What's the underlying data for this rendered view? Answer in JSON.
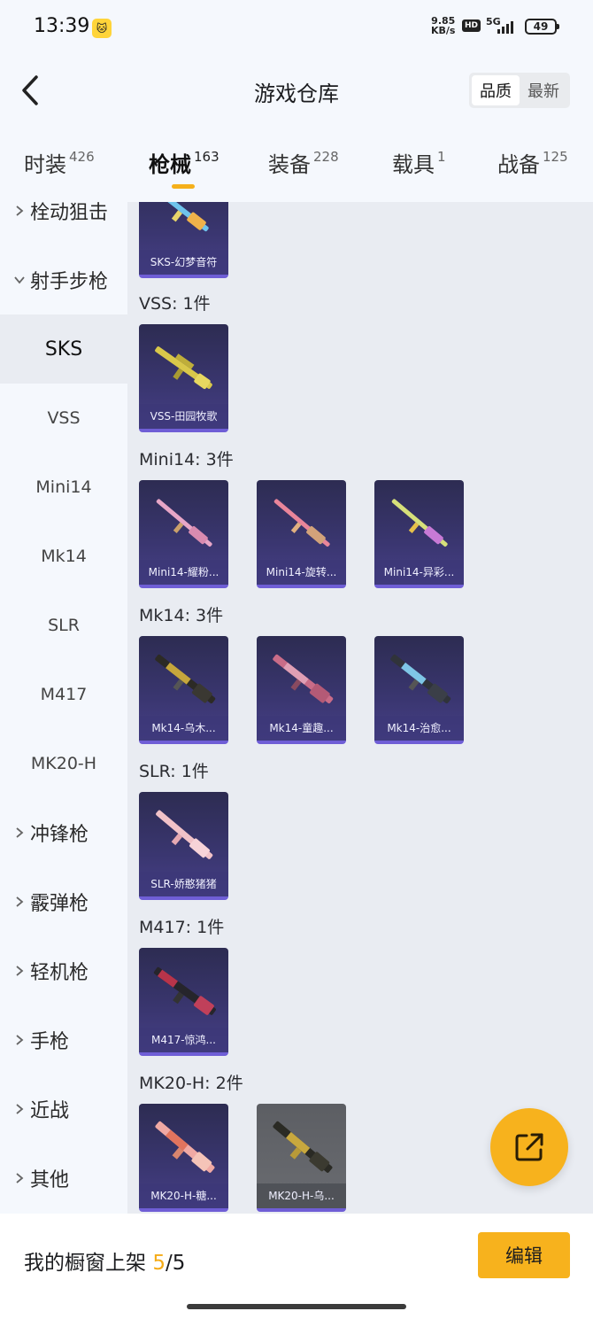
{
  "status_bar": {
    "time": "13:39",
    "speed_value": "9.85",
    "speed_unit": "KB/s",
    "hd": "HD",
    "network": "5G",
    "battery": "49"
  },
  "header": {
    "title": "游戏仓库",
    "sort_options": [
      "品质",
      "最新"
    ],
    "active_sort": "品质"
  },
  "tabs": [
    {
      "label": "时装",
      "count": "426"
    },
    {
      "label": "枪械",
      "count": "163",
      "active": true
    },
    {
      "label": "装备",
      "count": "228"
    },
    {
      "label": "载具",
      "count": "1"
    },
    {
      "label": "战备",
      "count": "125"
    }
  ],
  "sidebar": {
    "items": [
      {
        "label": "栓动狙击",
        "type": "group",
        "expanded": false
      },
      {
        "label": "射手步枪",
        "type": "group",
        "expanded": true
      },
      {
        "label": "SKS",
        "type": "sub",
        "active": true
      },
      {
        "label": "VSS",
        "type": "sub"
      },
      {
        "label": "Mini14",
        "type": "sub"
      },
      {
        "label": "Mk14",
        "type": "sub"
      },
      {
        "label": "SLR",
        "type": "sub"
      },
      {
        "label": "M417",
        "type": "sub"
      },
      {
        "label": "MK20-H",
        "type": "sub"
      },
      {
        "label": "冲锋枪",
        "type": "group",
        "expanded": false
      },
      {
        "label": "霰弹枪",
        "type": "group",
        "expanded": false
      },
      {
        "label": "轻机枪",
        "type": "group",
        "expanded": false
      },
      {
        "label": "手枪",
        "type": "group",
        "expanded": false
      },
      {
        "label": "近战",
        "type": "group",
        "expanded": false
      },
      {
        "label": "其他",
        "type": "group",
        "expanded": false
      }
    ]
  },
  "sections": [
    {
      "title": "",
      "items": [
        {
          "label": "SKS-幻梦音符",
          "icon": "rifle-skin-icon"
        }
      ]
    },
    {
      "title": "VSS: 1件",
      "items": [
        {
          "label": "VSS-田园牧歌",
          "icon": "rifle-skin-icon"
        }
      ]
    },
    {
      "title": "Mini14: 3件",
      "items": [
        {
          "label": "Mini14-耀粉...",
          "icon": "rifle-skin-icon"
        },
        {
          "label": "Mini14-旋转...",
          "icon": "rifle-skin-icon"
        },
        {
          "label": "Mini14-异彩...",
          "icon": "rifle-skin-icon"
        }
      ]
    },
    {
      "title": "Mk14: 3件",
      "items": [
        {
          "label": "Mk14-乌木...",
          "icon": "rifle-skin-icon"
        },
        {
          "label": "Mk14-童趣...",
          "icon": "rifle-skin-icon"
        },
        {
          "label": "Mk14-治愈...",
          "icon": "rifle-skin-icon"
        }
      ]
    },
    {
      "title": "SLR: 1件",
      "items": [
        {
          "label": "SLR-娇憨猪猪",
          "icon": "rifle-skin-icon"
        }
      ]
    },
    {
      "title": "M417: 1件",
      "items": [
        {
          "label": "M417-惊鸿...",
          "icon": "rifle-skin-icon"
        }
      ]
    },
    {
      "title": "MK20-H: 2件",
      "items": [
        {
          "label": "MK20-H-糖...",
          "icon": "rifle-skin-icon"
        },
        {
          "label": "MK20-H-乌...",
          "icon": "rifle-skin-icon",
          "grey": true
        }
      ]
    }
  ],
  "showcase": {
    "label": "我的橱窗上架",
    "current": "5",
    "total": "/5",
    "edit_label": "编辑"
  },
  "colors": {
    "accent": "#f7b21d",
    "card_bg": "#2d2c52",
    "card_border": "#6f5ed6",
    "page_bg": "#e9ecf2",
    "panel_bg": "#f5f8fd"
  }
}
